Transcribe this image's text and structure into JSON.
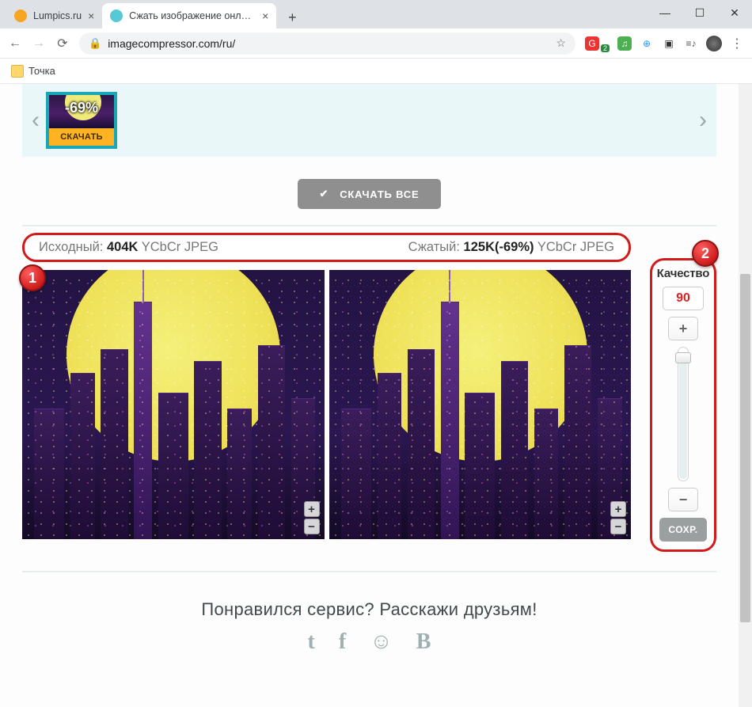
{
  "window": {
    "tabs": [
      {
        "title": "Lumpics.ru",
        "active": false
      },
      {
        "title": "Сжать изображение онлайн",
        "active": true
      }
    ],
    "address": "imagecompressor.com/ru/"
  },
  "bookmarks": {
    "folder": "Точка"
  },
  "carousel": {
    "thumb_badge": "-69%",
    "thumb_download": "СКАЧАТЬ"
  },
  "download_all": "СКАЧАТЬ ВСЕ",
  "info": {
    "original_label": "Исходный:",
    "original_size": "404K",
    "original_format": "YCbCr JPEG",
    "compressed_label": "Сжатый:",
    "compressed_size": "125K(-69%)",
    "compressed_format": "YCbCr JPEG"
  },
  "callouts": {
    "one": "1",
    "two": "2"
  },
  "quality": {
    "title": "Качество",
    "value": "90",
    "plus": "+",
    "minus": "−",
    "save": "СОХР."
  },
  "share": {
    "heading": "Понравился сервис? Расскажи друзьям!"
  }
}
